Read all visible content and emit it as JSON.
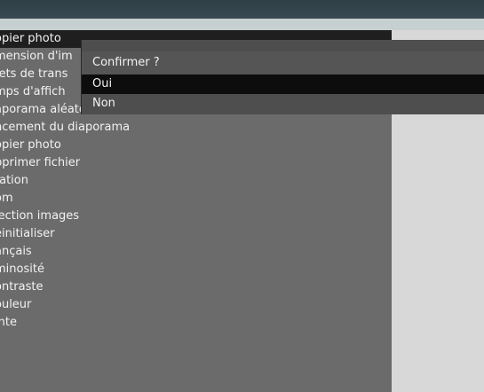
{
  "menu": {
    "items": [
      {
        "label": "opier photo",
        "selected": true
      },
      {
        "label": "mension d'im"
      },
      {
        "label": "fets de trans"
      },
      {
        "label": "mps d'affich"
      },
      {
        "label": "aporama aléatoire"
      },
      {
        "label": "ncement du diaporama"
      },
      {
        "label": "opier photo"
      },
      {
        "label": "pprimer fichier"
      },
      {
        "label": "tation"
      },
      {
        "label": "om"
      },
      {
        "label": "lection images"
      },
      {
        "label": "einitialiser"
      },
      {
        "label": "ançais"
      },
      {
        "label": "minosité"
      },
      {
        "label": "ontraste"
      },
      {
        "label": "ouleur"
      },
      {
        "label": "inte"
      }
    ]
  },
  "dialog": {
    "title": "Confirmer ?",
    "options": [
      {
        "label": "Oui",
        "selected": true
      },
      {
        "label": "Non"
      }
    ]
  },
  "colors": {
    "menu_bg": "#6b6b6b",
    "selected_bg": "#1f1f1f",
    "dialog_bg": "#4e4e4e",
    "topbar": "#2f3f46"
  }
}
